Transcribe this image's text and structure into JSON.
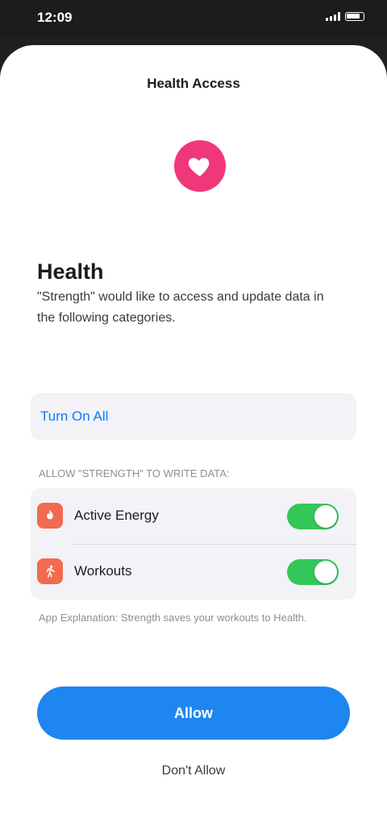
{
  "status_bar": {
    "time": "12:09"
  },
  "sheet": {
    "title": "Health Access"
  },
  "app_icon": "heart-icon",
  "intro": {
    "heading": "Health",
    "description": "\"Strength\" would like to access and update data in the following categories."
  },
  "turn_on_all": {
    "label": "Turn On All"
  },
  "permissions": {
    "section_header": "ALLOW \"STRENGTH\" TO WRITE DATA:",
    "items": [
      {
        "label": "Active Energy",
        "icon": "flame-icon",
        "enabled": true
      },
      {
        "label": "Workouts",
        "icon": "figure-run-icon",
        "enabled": true
      }
    ]
  },
  "footer": {
    "note": "App Explanation: Strength saves your workouts to Health."
  },
  "actions": {
    "allow_label": "Allow",
    "dont_allow_label": "Don't Allow"
  },
  "colors": {
    "accent": "#1e86f0",
    "heart": "#f0377a",
    "toggle_on": "#34c759",
    "category_icon": "#f26a4f"
  }
}
